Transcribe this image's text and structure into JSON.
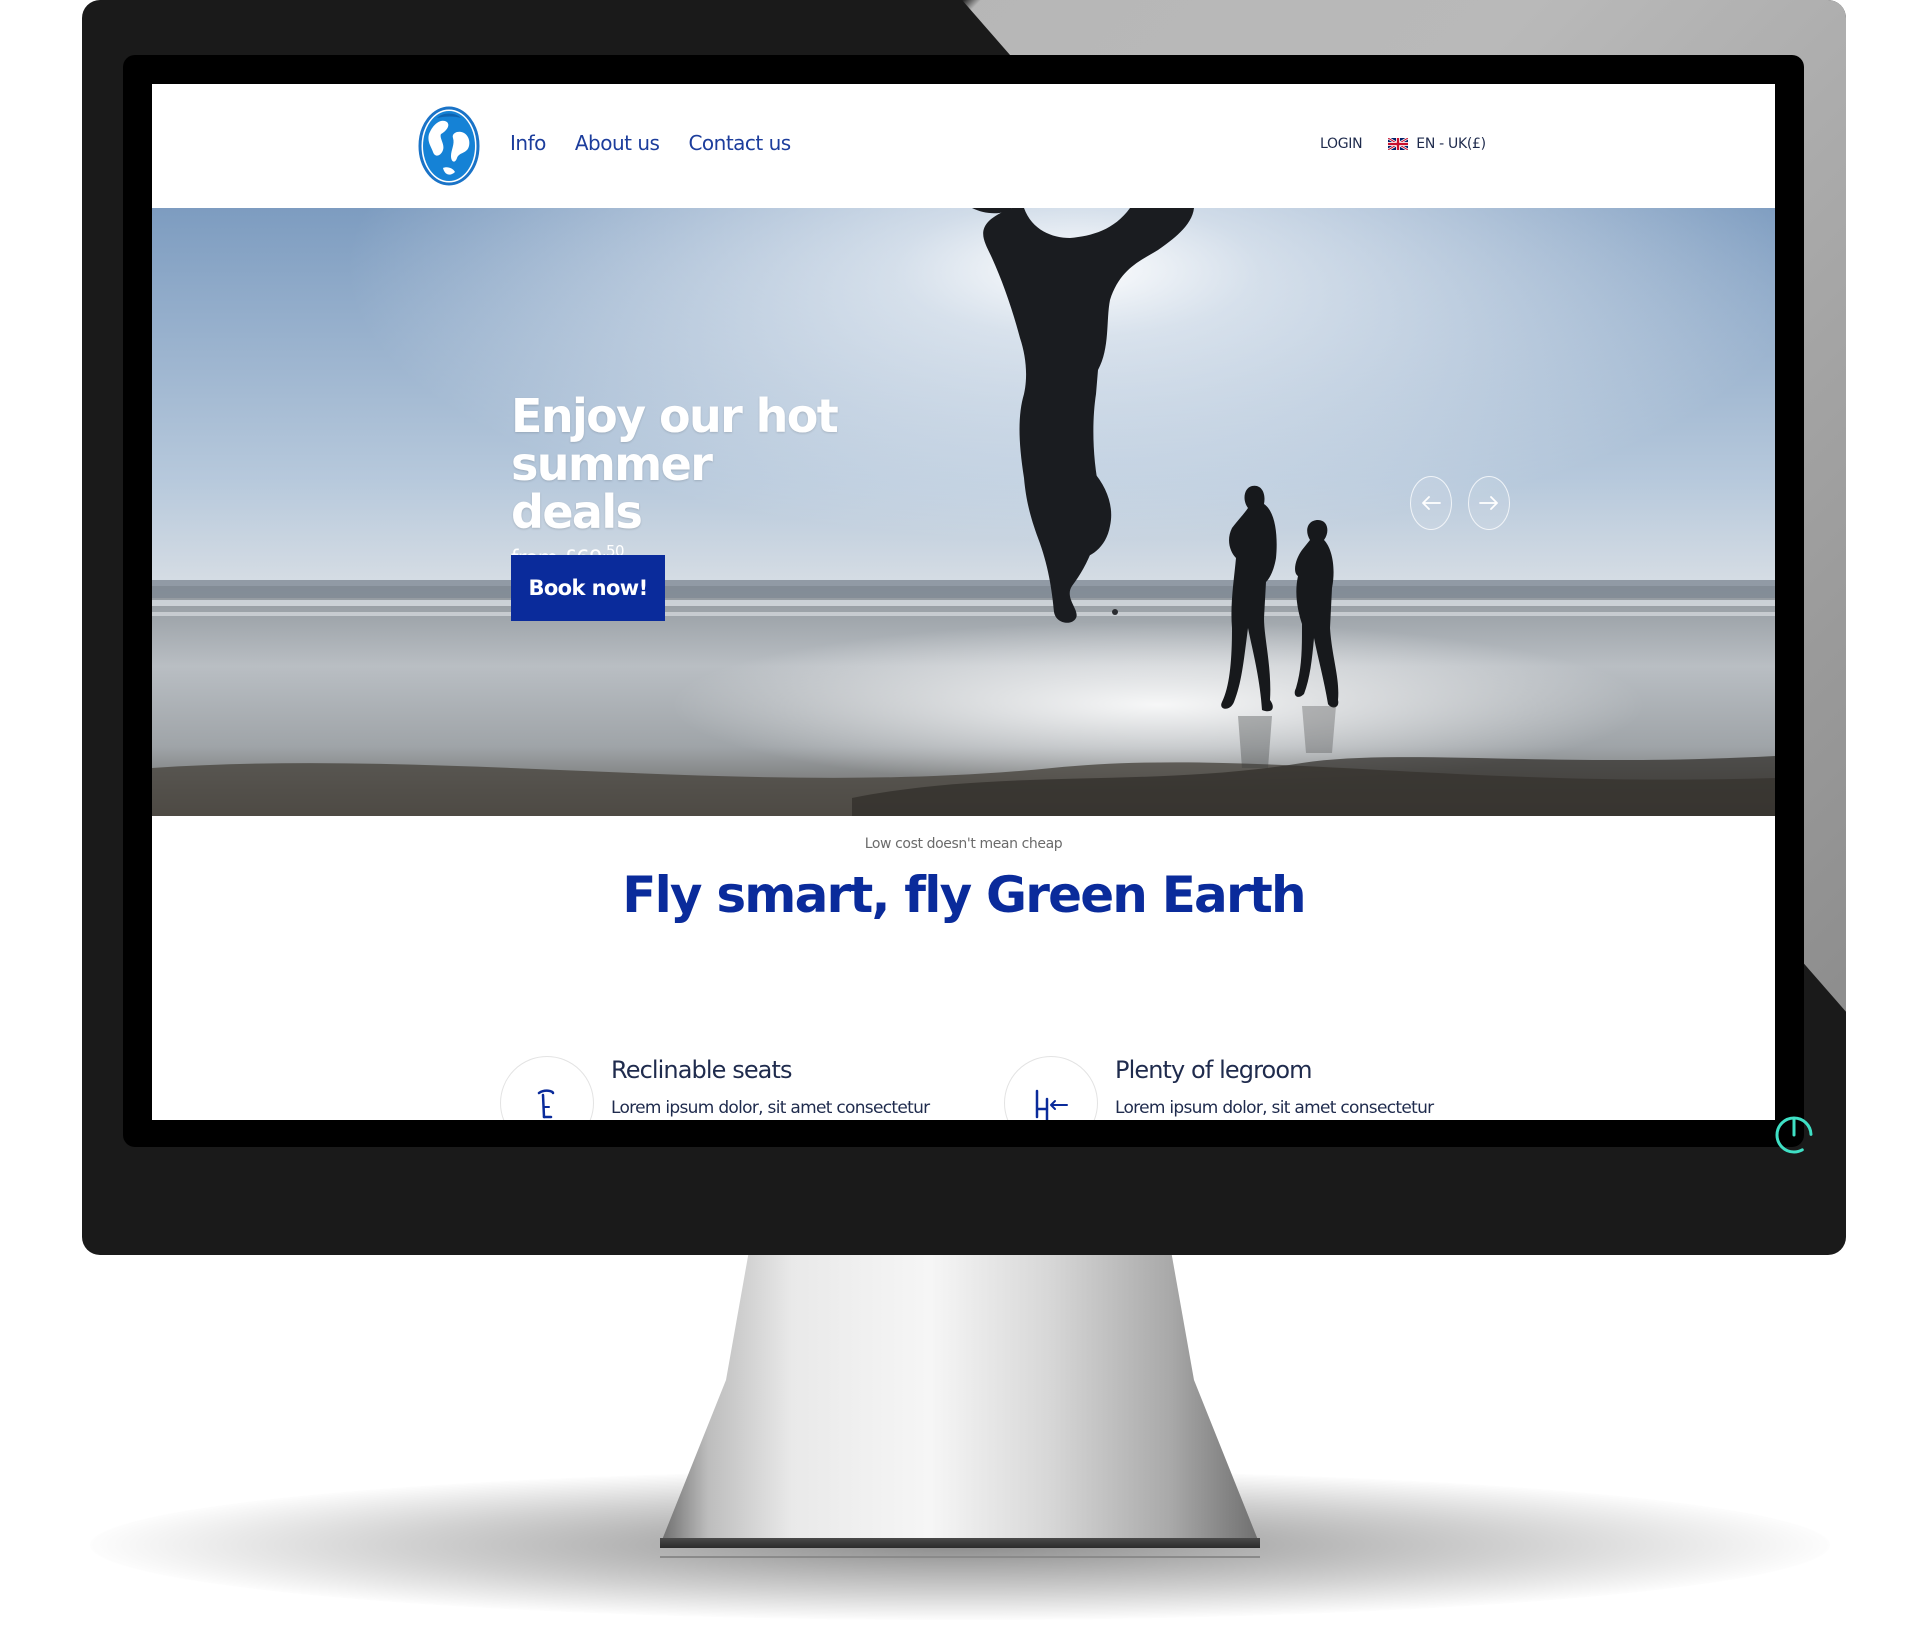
{
  "header": {
    "nav": [
      "Info",
      "About us",
      "Contact us"
    ],
    "login_label": "LOGIN",
    "language_label": "EN - UK(£)"
  },
  "hero": {
    "title_line1": "Enjoy our hot",
    "title_line2": "summer deals",
    "price_prefix": "from £69",
    "price_decimals": ".50",
    "cta_label": "Book now!"
  },
  "intro": {
    "subtitle": "Low cost doesn't mean cheap",
    "title": "Fly smart, fly Green Earth"
  },
  "features": [
    {
      "title": "Reclinable seats",
      "text": "Lorem ipsum dolor, sit amet consectetur",
      "icon": "reclining-seat-icon"
    },
    {
      "title": "Plenty of legroom",
      "text": "Lorem ipsum dolor, sit amet consectetur",
      "icon": "legroom-seat-icon"
    }
  ],
  "colors": {
    "brand_blue": "#0a2b9b",
    "nav_blue": "#1c3d9c",
    "text_dark": "#1f2b4d",
    "power_led": "#3fe0c5"
  }
}
